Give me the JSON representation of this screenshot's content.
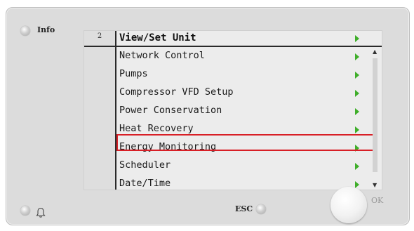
{
  "device": {
    "info_label": "Info",
    "esc_label": "ESC",
    "ok_label": "OK"
  },
  "screen": {
    "page_number": "2",
    "title": "View/Set Unit",
    "menu_items": [
      {
        "label": "Network Control",
        "has_submenu": true
      },
      {
        "label": "Pumps",
        "has_submenu": true
      },
      {
        "label": "Compressor VFD Setup",
        "has_submenu": true
      },
      {
        "label": "Power Conservation",
        "has_submenu": true
      },
      {
        "label": "Heat Recovery",
        "has_submenu": true
      },
      {
        "label": "Energy Monitoring",
        "has_submenu": true,
        "highlighted": true
      },
      {
        "label": "Scheduler",
        "has_submenu": true
      },
      {
        "label": "Date/Time",
        "has_submenu": true
      }
    ],
    "scroll_up_glyph": "▲",
    "scroll_down_glyph": "▼"
  },
  "colors": {
    "arrow": "#3fae2a",
    "highlight_border": "#d81f26",
    "panel": "#dcdcdc",
    "screen": "#ececec"
  },
  "icons": {
    "info": "led-indicator-icon",
    "alarm": "bell-icon",
    "esc": "led-indicator-icon",
    "ok": "rotary-knob-icon",
    "submenu": "green-right-arrow-icon"
  }
}
